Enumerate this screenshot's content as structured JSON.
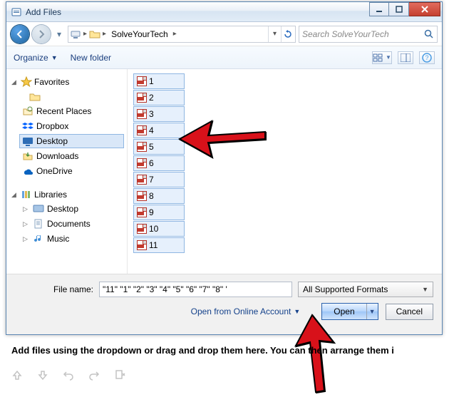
{
  "window": {
    "title": "Add Files",
    "path_segment": "SolveYourTech",
    "search_placeholder": "Search SolveYourTech"
  },
  "toolbar": {
    "organize": "Organize",
    "newfolder": "New folder"
  },
  "tree": {
    "favorites": "Favorites",
    "recent_places": "Recent Places",
    "dropbox": "Dropbox",
    "desktop": "Desktop",
    "downloads": "Downloads",
    "onedrive": "OneDrive",
    "libraries": "Libraries",
    "lib_desktop": "Desktop",
    "lib_documents": "Documents",
    "lib_music": "Music"
  },
  "files": [
    {
      "name": "1"
    },
    {
      "name": "2"
    },
    {
      "name": "3"
    },
    {
      "name": "4"
    },
    {
      "name": "5"
    },
    {
      "name": "6"
    },
    {
      "name": "7"
    },
    {
      "name": "8"
    },
    {
      "name": "9"
    },
    {
      "name": "10"
    },
    {
      "name": "11"
    }
  ],
  "footer": {
    "filename_label": "File name:",
    "filename_value": "\"11\" \"1\" \"2\" \"3\" \"4\" \"5\" \"6\" \"7\" \"8\" '",
    "filter": "All Supported Formats",
    "online": "Open from Online Account",
    "open": "Open",
    "cancel": "Cancel"
  },
  "page_hint": "Add files using the dropdown or drag and drop them here. You can then arrange them i"
}
